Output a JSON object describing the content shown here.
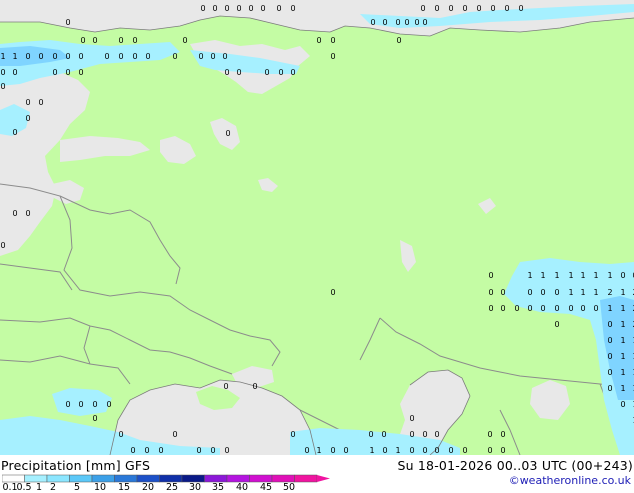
{
  "map": {
    "colors": {
      "land": "#c4fca4",
      "sea": "#e8e8e8",
      "border": "#8c8c8c",
      "coast": "#7c7c7c",
      "precip_light": "#a6f0ff",
      "precip_medium": "#7fd4ff",
      "precip_dark": "#3cb4e6"
    },
    "marker_values": [
      "0",
      "1",
      "2"
    ]
  },
  "footer": {
    "title": "Precipitation [mm]  GFS",
    "datetime": "Su 18-01-2026 00..03 UTC (00+243)",
    "credit": "©weatheronline.co.uk"
  },
  "legend": {
    "labels": [
      "0.1",
      "0.5",
      "1",
      "2",
      "5",
      "10",
      "15",
      "20",
      "25",
      "30",
      "35",
      "40",
      "45",
      "50"
    ],
    "colors": [
      "#fefefe",
      "#a6f0ff",
      "#8ce6ff",
      "#5cc8f8",
      "#3ca0e8",
      "#2a78d8",
      "#1c50c8",
      "#1030a8",
      "#0a1a88",
      "#8c18d8",
      "#b414e0",
      "#d010d0",
      "#e010b8",
      "#f014a0"
    ]
  }
}
